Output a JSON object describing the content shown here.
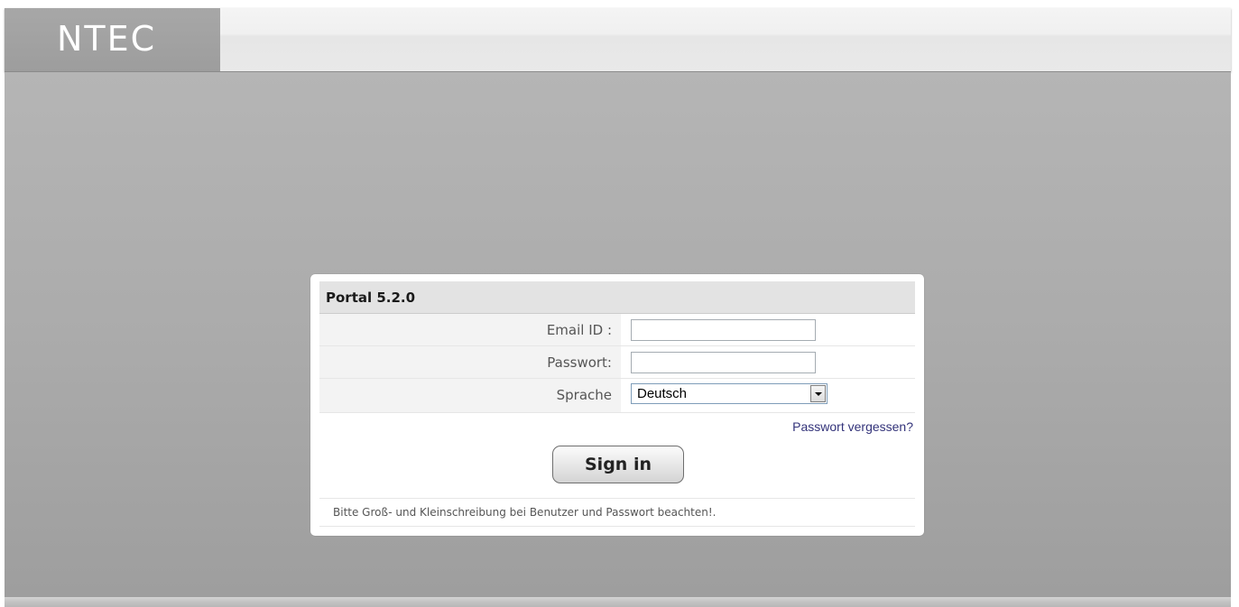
{
  "header": {
    "logo_text": "NTEC"
  },
  "login": {
    "title": "Portal 5.2.0",
    "email_label": "Email ID :",
    "email_value": "",
    "password_label": "Passwort:",
    "password_value": "",
    "language_label": "Sprache",
    "language_selected": "Deutsch",
    "forgot_password": "Passwort vergessen?",
    "signin_label": "Sign in",
    "note": "Bitte Groß- und Kleinschreibung bei Benutzer und Passwort beachten!."
  },
  "colors": {
    "link": "#33337a",
    "logo_bg": "#a3a3a3",
    "page_bg": "#ababab"
  }
}
